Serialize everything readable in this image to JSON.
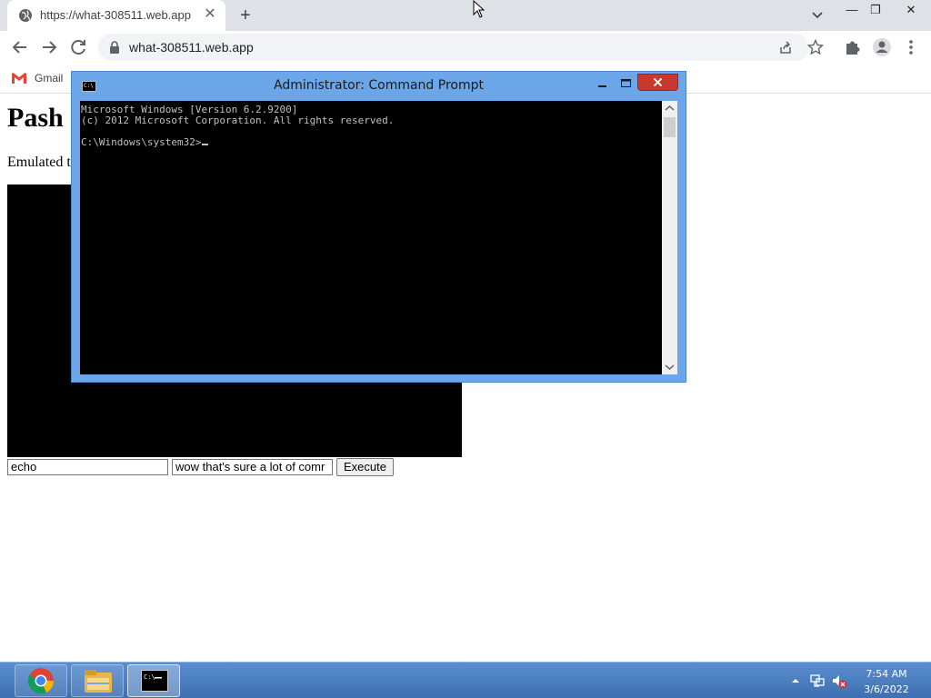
{
  "browser": {
    "tab": {
      "title": "https://what-308511.web.app",
      "favicon": "globe-icon"
    },
    "url": "what-308511.web.app",
    "bookmarks": [
      {
        "label": "Gmail",
        "icon": "gmail-icon"
      }
    ]
  },
  "page": {
    "heading": "Pash",
    "intro": "Emulated t",
    "command_value": "echo",
    "args_value": "wow that's sure a lot of comr",
    "execute_label": "Execute"
  },
  "cmd": {
    "title": "Administrator: Command Prompt",
    "lines": [
      "Microsoft Windows [Version 6.2.9200]",
      "(c) 2012 Microsoft Corporation. All rights reserved.",
      "",
      "C:\\Windows\\system32>"
    ]
  },
  "taskbar": {
    "apps": [
      "chrome-icon",
      "file-explorer-icon",
      "command-prompt-icon"
    ],
    "time": "7:54 AM",
    "date": "3/6/2022"
  },
  "colors": {
    "cmd_frame": "#6ba7e8",
    "cmd_close": "#c7392f",
    "taskbar": "#4a7fc1"
  }
}
